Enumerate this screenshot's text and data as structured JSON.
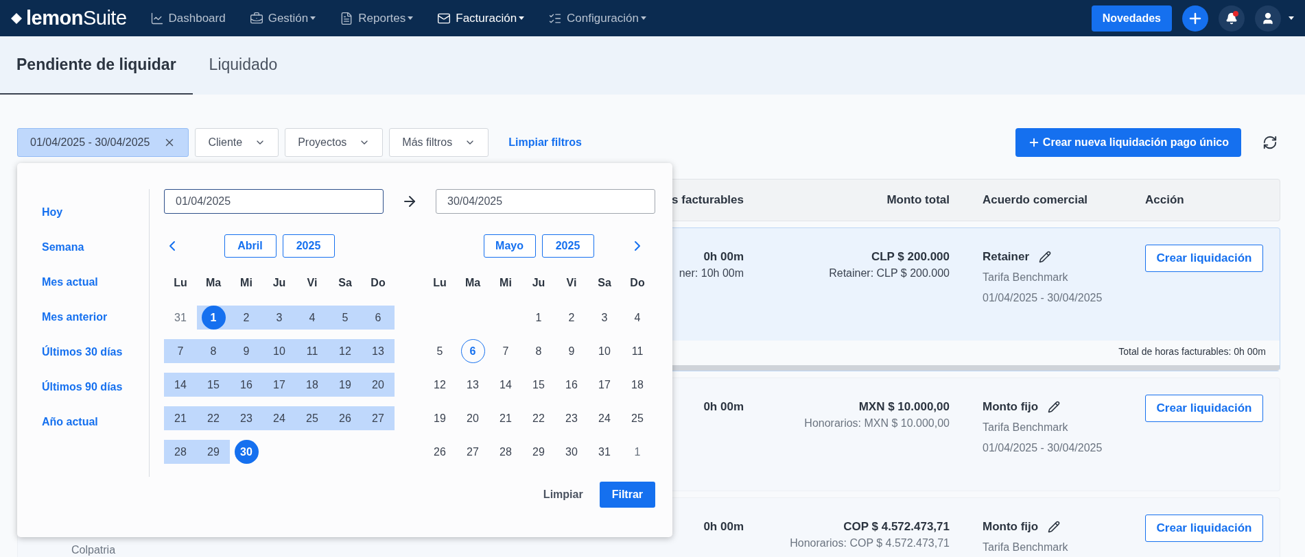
{
  "navbar": {
    "logo": "**lemon**Suite",
    "menu": [
      {
        "label": "Dashboard",
        "dropdown": false,
        "selected": false
      },
      {
        "label": "Gestión",
        "dropdown": true,
        "selected": false
      },
      {
        "label": "Reportes",
        "dropdown": true,
        "selected": false
      },
      {
        "label": "Facturación",
        "dropdown": true,
        "selected": true
      },
      {
        "label": "Configuración",
        "dropdown": true,
        "selected": false
      }
    ],
    "news_button": "Novedades",
    "notifications_unread": true
  },
  "tabs": [
    {
      "label": "Pendiente de liquidar",
      "selected": true
    },
    {
      "label": "Liquidado",
      "selected": false
    }
  ],
  "filters": {
    "date_range": "01/04/2025 - 30/04/2025",
    "dropdowns": [
      "Cliente",
      "Proyectos",
      "Más filtros"
    ],
    "clear_link": "Limpiar filtros",
    "create_button": "Crear nueva liquidación pago único"
  },
  "table": {
    "columns": [
      "s facturables",
      "Monto total",
      "Acuerdo comercial",
      "Acción"
    ],
    "rows": [
      {
        "selected": true,
        "hours": "0h 00m",
        "hours_detail": "ner: 10h 00m",
        "amount": "CLP $ 200.000",
        "amount_detail": "Retainer: CLP $ 200.000",
        "agreement": "Retainer",
        "rate": "Tarifa Benchmark",
        "period": "01/04/2025 - 30/04/2025",
        "action": "Crear liquidación",
        "footer": "Total de horas facturables: 0h 00m"
      },
      {
        "selected": false,
        "hours": "0h 00m",
        "amount": "MXN $ 10.000,00",
        "amount_detail": "Honorarios: MXN $ 10.000,00",
        "agreement": "Monto fijo",
        "rate": "Tarifa Benchmark",
        "period": "01/04/2025 - 30/04/2025",
        "action": "Crear liquidación"
      },
      {
        "selected": false,
        "client": "Colpatria",
        "hours": "0h 00m",
        "amount": "COP $ 4.572.473,71",
        "amount_detail": "Honorarios: COP $ 4.572.473,71",
        "agreement": "Monto fijo",
        "rate": "Tarifa Benchmark",
        "action": "Crear liquidación"
      }
    ]
  },
  "date_picker": {
    "presets": [
      "Hoy",
      "Semana",
      "Mes actual",
      "Mes anterior",
      "Últimos 30 días",
      "Últimos 90 días",
      "Año actual"
    ],
    "start": "01/04/2025",
    "end": "30/04/2025",
    "months": [
      {
        "month": "Abril",
        "year": "2025",
        "weekdays": [
          "Lu",
          "Ma",
          "Mi",
          "Ju",
          "Vi",
          "Sa",
          "Do"
        ],
        "days": [
          {
            "kind": "outside",
            "label": "31",
            "in_range": false,
            "selected": false,
            "today": false
          },
          {
            "kind": "day",
            "label": "1",
            "in_range": true,
            "selected": true,
            "today": false
          },
          {
            "kind": "day",
            "label": "2",
            "in_range": true,
            "selected": false,
            "today": false
          },
          {
            "kind": "day",
            "label": "3",
            "in_range": true,
            "selected": false,
            "today": false
          },
          {
            "kind": "day",
            "label": "4",
            "in_range": true,
            "selected": false,
            "today": false
          },
          {
            "kind": "day",
            "label": "5",
            "in_range": true,
            "selected": false,
            "today": false
          },
          {
            "kind": "day",
            "label": "6",
            "in_range": true,
            "selected": false,
            "today": false
          },
          {
            "kind": "day",
            "label": "7",
            "in_range": true,
            "selected": false,
            "today": false
          },
          {
            "kind": "day",
            "label": "8",
            "in_range": true,
            "selected": false,
            "today": false
          },
          {
            "kind": "day",
            "label": "9",
            "in_range": true,
            "selected": false,
            "today": false
          },
          {
            "kind": "day",
            "label": "10",
            "in_range": true,
            "selected": false,
            "today": false
          },
          {
            "kind": "day",
            "label": "11",
            "in_range": true,
            "selected": false,
            "today": false
          },
          {
            "kind": "day",
            "label": "12",
            "in_range": true,
            "selected": false,
            "today": false
          },
          {
            "kind": "day",
            "label": "13",
            "in_range": true,
            "selected": false,
            "today": false
          },
          {
            "kind": "day",
            "label": "14",
            "in_range": true,
            "selected": false,
            "today": false
          },
          {
            "kind": "day",
            "label": "15",
            "in_range": true,
            "selected": false,
            "today": false
          },
          {
            "kind": "day",
            "label": "16",
            "in_range": true,
            "selected": false,
            "today": false
          },
          {
            "kind": "day",
            "label": "17",
            "in_range": true,
            "selected": false,
            "today": false
          },
          {
            "kind": "day",
            "label": "18",
            "in_range": true,
            "selected": false,
            "today": false
          },
          {
            "kind": "day",
            "label": "19",
            "in_range": true,
            "selected": false,
            "today": false
          },
          {
            "kind": "day",
            "label": "20",
            "in_range": true,
            "selected": false,
            "today": false
          },
          {
            "kind": "day",
            "label": "21",
            "in_range": true,
            "selected": false,
            "today": false
          },
          {
            "kind": "day",
            "label": "22",
            "in_range": true,
            "selected": false,
            "today": false
          },
          {
            "kind": "day",
            "label": "23",
            "in_range": true,
            "selected": false,
            "today": false
          },
          {
            "kind": "day",
            "label": "24",
            "in_range": true,
            "selected": false,
            "today": false
          },
          {
            "kind": "day",
            "label": "25",
            "in_range": true,
            "selected": false,
            "today": false
          },
          {
            "kind": "day",
            "label": "26",
            "in_range": true,
            "selected": false,
            "today": false
          },
          {
            "kind": "day",
            "label": "27",
            "in_range": true,
            "selected": false,
            "today": false
          },
          {
            "kind": "day",
            "label": "28",
            "in_range": true,
            "selected": false,
            "today": false
          },
          {
            "kind": "day",
            "label": "29",
            "in_range": true,
            "selected": false,
            "today": false
          },
          {
            "kind": "day",
            "label": "30",
            "in_range": false,
            "selected": true,
            "today": false
          }
        ]
      },
      {
        "month": "Mayo",
        "year": "2025",
        "weekdays": [
          "Lu",
          "Ma",
          "Mi",
          "Ju",
          "Vi",
          "Sa",
          "Do"
        ],
        "days": [
          {
            "kind": "blank"
          },
          {
            "kind": "blank"
          },
          {
            "kind": "blank"
          },
          {
            "kind": "day",
            "label": "1",
            "in_range": false,
            "selected": false,
            "today": false
          },
          {
            "kind": "day",
            "label": "2",
            "in_range": false,
            "selected": false,
            "today": false
          },
          {
            "kind": "day",
            "label": "3",
            "in_range": false,
            "selected": false,
            "today": false
          },
          {
            "kind": "day",
            "label": "4",
            "in_range": false,
            "selected": false,
            "today": false
          },
          {
            "kind": "day",
            "label": "5",
            "in_range": false,
            "selected": false,
            "today": false
          },
          {
            "kind": "day",
            "label": "6",
            "in_range": false,
            "selected": false,
            "today": true
          },
          {
            "kind": "day",
            "label": "7",
            "in_range": false,
            "selected": false,
            "today": false
          },
          {
            "kind": "day",
            "label": "8",
            "in_range": false,
            "selected": false,
            "today": false
          },
          {
            "kind": "day",
            "label": "9",
            "in_range": false,
            "selected": false,
            "today": false
          },
          {
            "kind": "day",
            "label": "10",
            "in_range": false,
            "selected": false,
            "today": false
          },
          {
            "kind": "day",
            "label": "11",
            "in_range": false,
            "selected": false,
            "today": false
          },
          {
            "kind": "day",
            "label": "12",
            "in_range": false,
            "selected": false,
            "today": false
          },
          {
            "kind": "day",
            "label": "13",
            "in_range": false,
            "selected": false,
            "today": false
          },
          {
            "kind": "day",
            "label": "14",
            "in_range": false,
            "selected": false,
            "today": false
          },
          {
            "kind": "day",
            "label": "15",
            "in_range": false,
            "selected": false,
            "today": false
          },
          {
            "kind": "day",
            "label": "16",
            "in_range": false,
            "selected": false,
            "today": false
          },
          {
            "kind": "day",
            "label": "17",
            "in_range": false,
            "selected": false,
            "today": false
          },
          {
            "kind": "day",
            "label": "18",
            "in_range": false,
            "selected": false,
            "today": false
          },
          {
            "kind": "day",
            "label": "19",
            "in_range": false,
            "selected": false,
            "today": false
          },
          {
            "kind": "day",
            "label": "20",
            "in_range": false,
            "selected": false,
            "today": false
          },
          {
            "kind": "day",
            "label": "21",
            "in_range": false,
            "selected": false,
            "today": false
          },
          {
            "kind": "day",
            "label": "22",
            "in_range": false,
            "selected": false,
            "today": false
          },
          {
            "kind": "day",
            "label": "23",
            "in_range": false,
            "selected": false,
            "today": false
          },
          {
            "kind": "day",
            "label": "24",
            "in_range": false,
            "selected": false,
            "today": false
          },
          {
            "kind": "day",
            "label": "25",
            "in_range": false,
            "selected": false,
            "today": false
          },
          {
            "kind": "day",
            "label": "26",
            "in_range": false,
            "selected": false,
            "today": false
          },
          {
            "kind": "day",
            "label": "27",
            "in_range": false,
            "selected": false,
            "today": false
          },
          {
            "kind": "day",
            "label": "28",
            "in_range": false,
            "selected": false,
            "today": false
          },
          {
            "kind": "day",
            "label": "29",
            "in_range": false,
            "selected": false,
            "today": false
          },
          {
            "kind": "day",
            "label": "30",
            "in_range": false,
            "selected": false,
            "today": false
          },
          {
            "kind": "day",
            "label": "31",
            "in_range": false,
            "selected": false,
            "today": false
          },
          {
            "kind": "outside",
            "label": "1",
            "in_range": false,
            "selected": false,
            "today": false
          }
        ]
      }
    ],
    "clear_button": "Limpiar",
    "apply_button": "Filtrar"
  }
}
